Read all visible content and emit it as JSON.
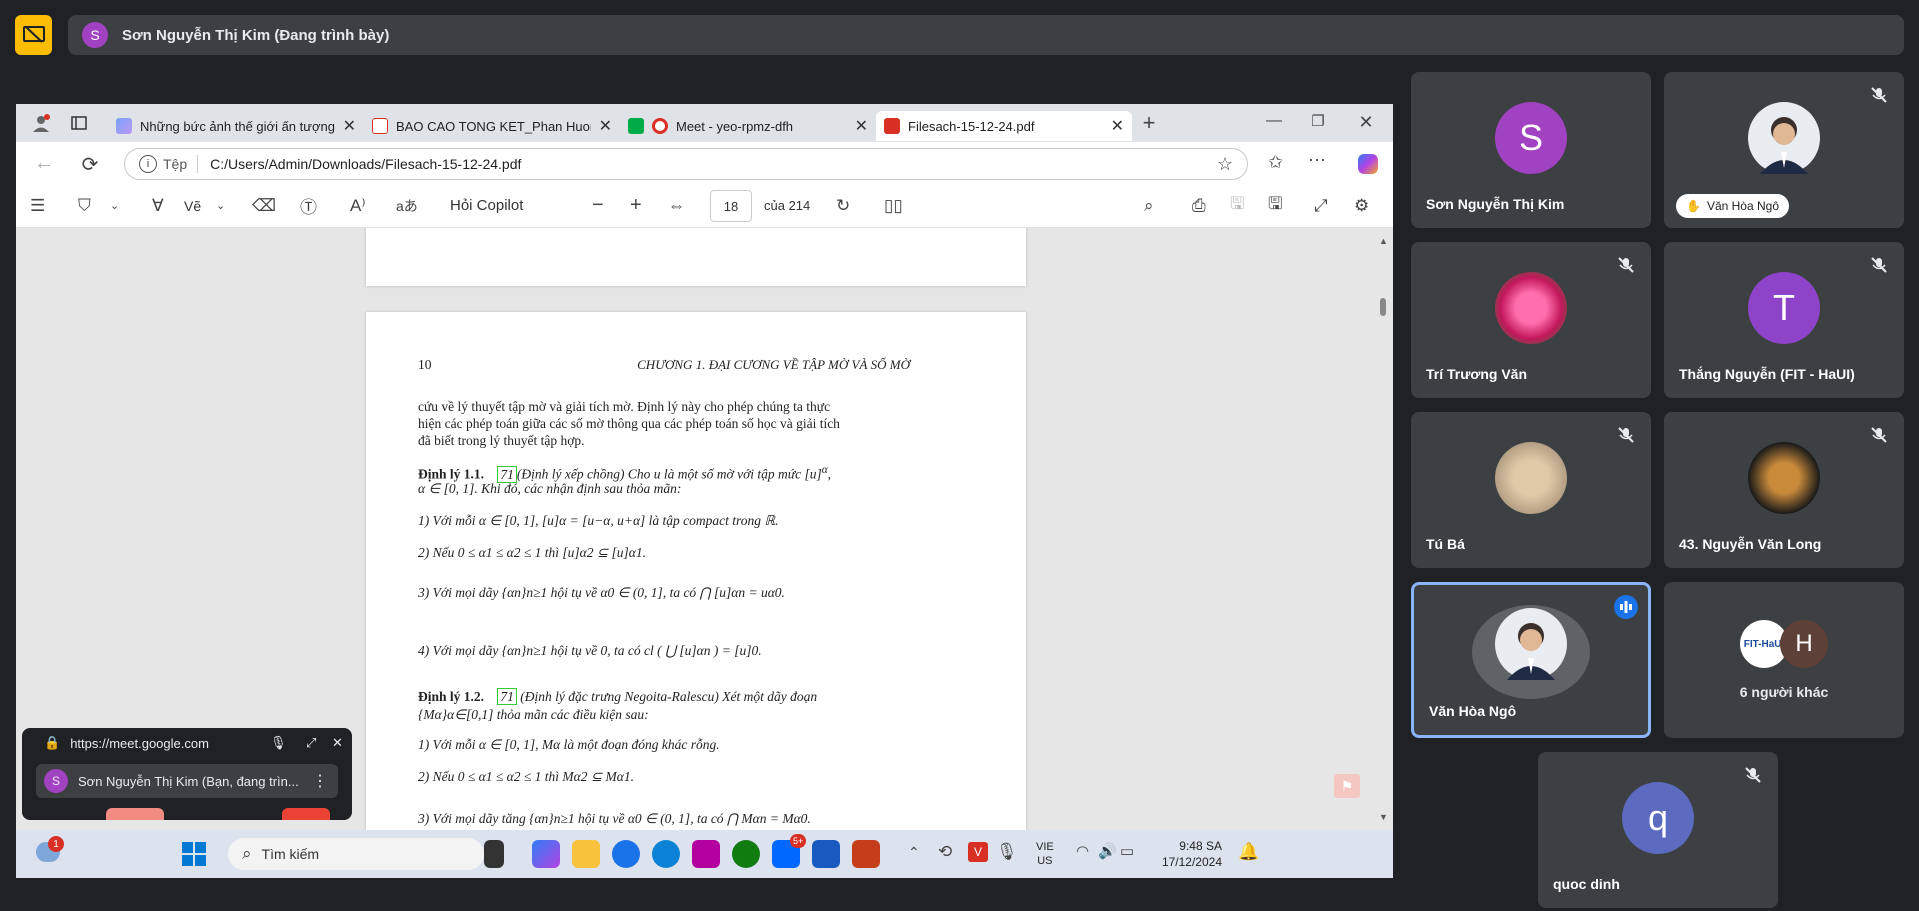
{
  "meet": {
    "presenter_label": "Sơn Nguyễn Thị Kim (Đang trình bày)",
    "presenter_initial": "S",
    "participants": [
      {
        "name": "Sơn Nguyễn Thị Kim",
        "initial": "S",
        "color": "#a142c2"
      },
      {
        "name": "",
        "badge": "Văn Hòa Ngô"
      },
      {
        "name": "Trí Trương Văn"
      },
      {
        "name": "Thắng Nguyễn (FIT - HaUI)",
        "initial": "T",
        "color": "#8e44c8"
      },
      {
        "name": "Tú Bá"
      },
      {
        "name": "43. Nguyễn Văn Long"
      },
      {
        "name": "Văn Hòa Ngô"
      },
      {
        "name": "6 người khác",
        "initial": "H",
        "logo": "FIT-HaUI"
      },
      {
        "name": "quoc dinh",
        "initial": "q",
        "color": "#5c6bc0"
      }
    ],
    "mini_window": {
      "url": "https://meet.google.com",
      "self_label": "Sơn Nguyễn Thị Kim (Bạn, đang trìn...",
      "initial": "S"
    }
  },
  "browser": {
    "tabs": [
      {
        "title": "Những bức ảnh thế giới ấn tượng"
      },
      {
        "title": "BAO CAO TONG KET_Phan Huong"
      },
      {
        "title": "Meet - yeo-rpmz-dfh"
      },
      {
        "title": "Filesach-15-12-24.pdf"
      }
    ],
    "address_label": "Tệp",
    "url": "C:/Users/Admin/Downloads/Filesach-15-12-24.pdf"
  },
  "pdf_toolbar": {
    "draw_label": "Vẽ",
    "copilot_label": "Hỏi Copilot",
    "page_number": "18",
    "page_of": "của 214"
  },
  "pdf": {
    "page_num": "10",
    "header": "CHƯƠNG 1.  ĐẠI CƯƠNG VỀ TẬP MỜ VÀ SỐ MỜ",
    "para1": "cứu về lý thuyết tập mờ và giải tích mờ. Định lý này cho phép chúng ta thực",
    "para2": "hiện các phép toán giữa các số mờ thông qua các phép toán số học và giải tích",
    "para3": "đã biết trong lý thuyết tập hợp.",
    "thm1_title": "Định lý 1.1.",
    "thm1_ref": "71",
    "thm1_text": "(Định lý xếp chồng) Cho u là một số mờ với tập mức [u]",
    "thm1_line2": "α ∈ [0, 1]. Khi đó, các nhận định sau thỏa mãn:",
    "thm1_items": [
      "1)  Với mỗi α ∈ [0, 1], [u]α = [u−α, u+α] là tập compact trong ℝ.",
      "2)  Nếu 0 ≤ α1 ≤ α2 ≤ 1 thì [u]α2 ⊆ [u]α1.",
      "3)  Với mọi dãy {αn}n≥1 hội tụ về α0 ∈ (0, 1], ta có ⋂ [u]αn = uα0.",
      "4)  Với mọi dãy {αn}n≥1 hội tụ về 0, ta có cl ( ⋃ [u]αn ) = [u]0."
    ],
    "thm2_title": "Định lý 1.2.",
    "thm2_ref": "71",
    "thm2_text": "(Định lý đặc trưng Negoita-Ralescu) Xét một dãy đoạn",
    "thm2_line2": "{Mα}α∈[0,1] thỏa mãn các điều kiện sau:",
    "thm2_items": [
      "1)  Với mỗi α ∈ [0, 1], Mα là một đoạn đóng khác rỗng.",
      "2)  Nếu 0 ≤ α1 ≤ α2 ≤ 1 thì Mα2 ⊆ Mα1.",
      "3)  Với mọi dãy tăng {αn}n≥1 hội tụ về α0 ∈ (0, 1], ta có ⋂ Mαn = Mα0."
    ]
  },
  "taskbar": {
    "search_label": "Tìm kiếm",
    "lang1": "VIE",
    "lang2": "US",
    "time": "9:48 SA",
    "date": "17/12/2024",
    "notif_count": "1",
    "zalo_badge": "5+"
  }
}
